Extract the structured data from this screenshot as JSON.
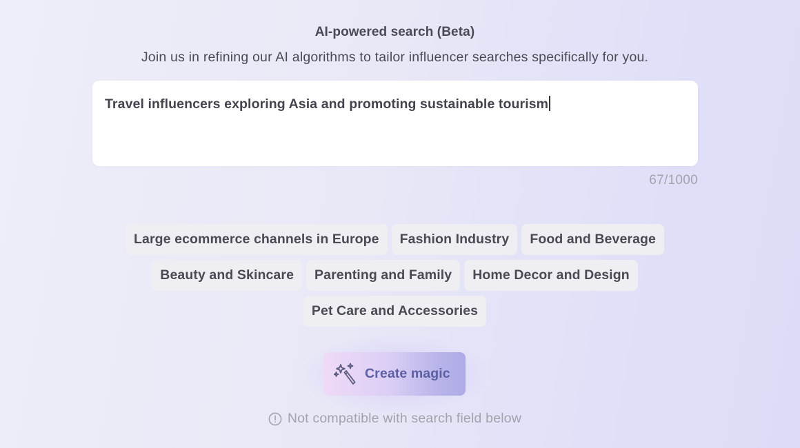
{
  "header": {
    "title": "AI-powered search (Beta)",
    "subtitle": "Join us in refining our AI algorithms to tailor influencer searches specifically for you."
  },
  "search": {
    "value": "Travel influencers exploring Asia and promoting sustainable tourism",
    "counter": "67/1000"
  },
  "suggestions": {
    "rows": [
      [
        "Large ecommerce channels in Europe",
        "Fashion Industry",
        "Food and Beverage"
      ],
      [
        "Beauty and Skincare",
        "Parenting and Family",
        "Home Decor and Design"
      ],
      [
        "Pet Care and Accessories"
      ]
    ]
  },
  "magic_button": {
    "label": "Create magic",
    "icon": "magic-wand-icon"
  },
  "notice": {
    "text": "Not compatible with search field below",
    "icon": "alert-circle-icon"
  },
  "colors": {
    "accent_text": "#5d5fa3",
    "muted_text": "#a3a3ad",
    "chip_bg": "#efeff3",
    "button_gradient_start": "#efdaf7",
    "button_gradient_end": "#aeaae6"
  }
}
